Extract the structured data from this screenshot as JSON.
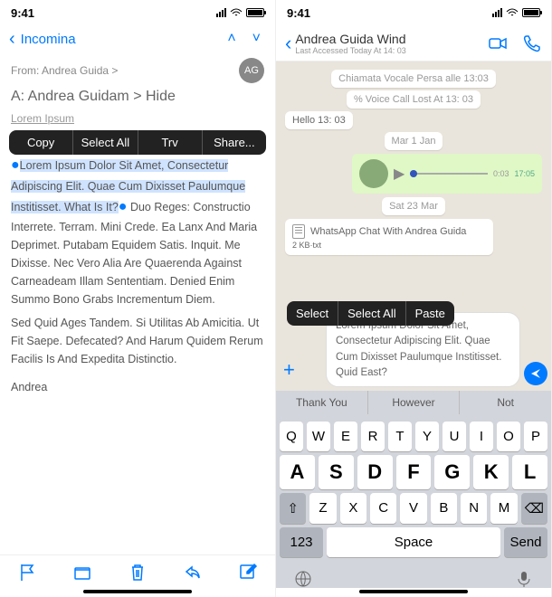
{
  "status": {
    "time": "9:41"
  },
  "mail": {
    "back": "Incomina",
    "from_label": "From: Andrea Guida >",
    "avatar": "AG",
    "subject": "A: Andrea Guidam > Hide",
    "ipsum_label": "Lorem Ipsum",
    "popup": {
      "c1": "Copy",
      "c2": "Select All",
      "c3": "Trv",
      "c4": "Share..."
    },
    "body_sel": "Lorem Ipsum Dolor Sit Amet, Consectetur Adipiscing Elit. Quae Cum Dixisset Paulumque Institisset. What Is It?",
    "body_rest": " Duo Reges: Constructio Interrete. Terram. Mini Crede. Ea Lanx And Maria Deprimet. Putabam Equidem Satis. Inquit. Me Dixisse. Nec Vero Alia Are Quaerenda Against Carneadeam Illam Sententiam. Denied Enim Summo Bono Grabs Incrementum Diem.",
    "body2": "Sed Quid Ages Tandem. Si Utilitas Ab Amicitia. Ut Fit Saepe. Defecated? And Harum Quidem Rerum Facilis Is And Expedita Distinctio.",
    "signature": "Andrea"
  },
  "wa": {
    "name": "Andrea Guida Wind",
    "access": "Last Accessed Today At 14: 03",
    "sys1": "Chiamata Vocale Persa alle 13:03",
    "sys2": "% Voice Call Lost At 13: 03",
    "hello": "Hello 13: 03",
    "date1": "Mar 1 Jan",
    "voice_dur": "0:03",
    "voice_time": "17:05",
    "date2": "Sat 23 Mar",
    "doc_title": "WhatsApp Chat With Andrea Guida",
    "doc_meta": "2 KB·txt",
    "popup": {
      "c1": "Select",
      "c2": "Select All",
      "c3": "Paste"
    },
    "compose": "Lorem Ipsum Dolor Sit Amet, Consectetur Adipiscing Elit. Quae Cum Dixisset Paulumque Institisset. Quid East?",
    "sugg": {
      "s1": "Thank You",
      "s2": "However",
      "s3": "Not"
    },
    "keys": {
      "r1": [
        "Q",
        "W",
        "E",
        "R",
        "T",
        "Y",
        "U",
        "I",
        "O",
        "P"
      ],
      "r2": [
        "A",
        "S",
        "D",
        "F",
        "G",
        "K",
        "L"
      ],
      "r3": [
        "Z",
        "X",
        "C",
        "V",
        "B",
        "N",
        "M"
      ],
      "num": "123",
      "space": "Space",
      "send": "Send"
    }
  }
}
